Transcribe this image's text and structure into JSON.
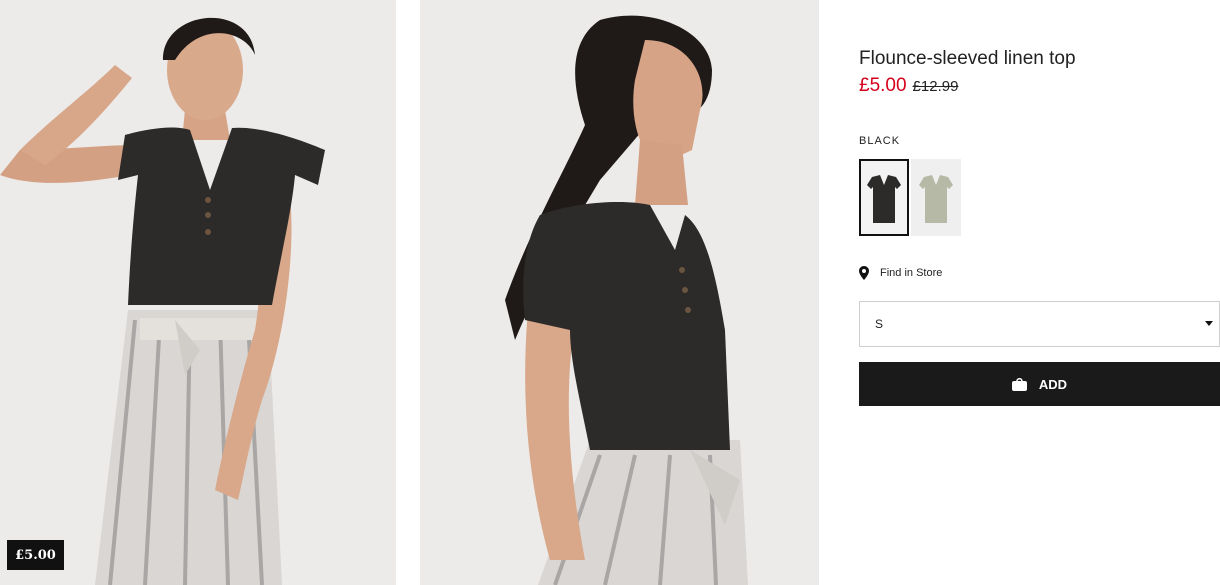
{
  "product": {
    "title": "Flounce-sleeved linen top",
    "price_sale": "£5.00",
    "price_original": "£12.99",
    "color_label": "BLACK",
    "colors": {
      "sale": "#d6001c",
      "button": "#1a1a1a",
      "garment_black": "#2c2b29",
      "garment_green": "#b5b9a6"
    }
  },
  "images": [
    {
      "name": "model-front-photo",
      "price_tag": "£5.00"
    },
    {
      "name": "model-side-photo"
    }
  ],
  "swatches": [
    {
      "name": "black",
      "selected": true
    },
    {
      "name": "light-khaki-green",
      "selected": false
    }
  ],
  "store": {
    "label": "Find in Store",
    "icon": "location-pin-icon"
  },
  "size_select": {
    "value": "S",
    "icon": "caret-down-icon"
  },
  "add_button": {
    "label": "ADD",
    "icon": "shopping-bag-icon"
  }
}
